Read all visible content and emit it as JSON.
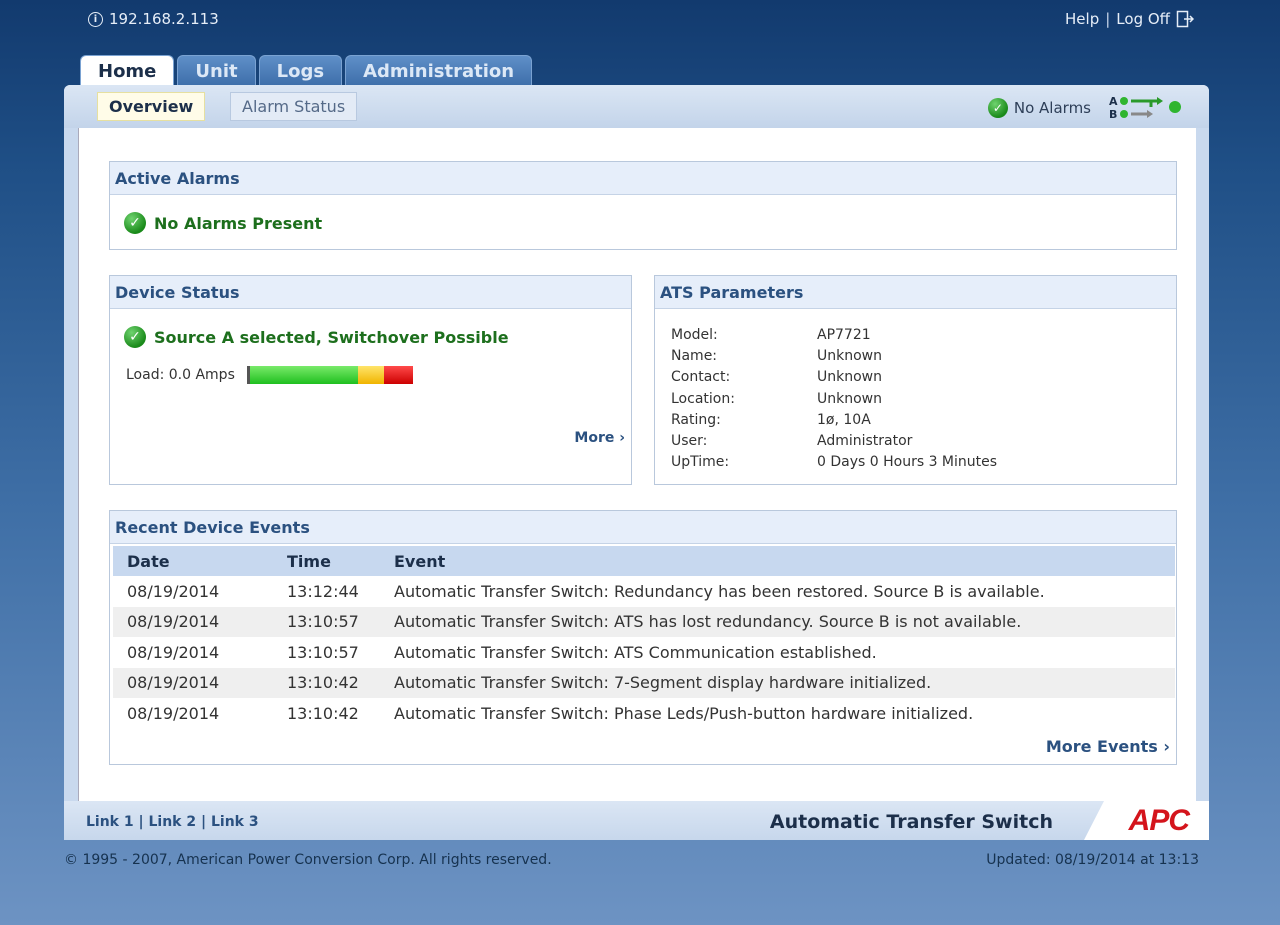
{
  "header": {
    "ip": "192.168.2.113",
    "help": "Help",
    "separator": "|",
    "logoff": "Log Off"
  },
  "tabs": [
    {
      "label": "Home"
    },
    {
      "label": "Unit"
    },
    {
      "label": "Logs"
    },
    {
      "label": "Administration"
    }
  ],
  "subtabs": [
    {
      "label": "Overview"
    },
    {
      "label": "Alarm Status"
    }
  ],
  "alarm_state": "No Alarms",
  "ats_status_icon": {
    "top_letter": "A",
    "bottom_letter": "B"
  },
  "active_alarms": {
    "title": "Active Alarms",
    "message": "No Alarms Present"
  },
  "device_status": {
    "title": "Device Status",
    "message": "Source A selected, Switchover Possible",
    "load_label": "Load: 0.0 Amps",
    "load_fraction": 0.0,
    "more": "More ›"
  },
  "ats_parameters": {
    "title": "ATS Parameters",
    "rows": [
      {
        "key": "Model:",
        "value": "AP7721"
      },
      {
        "key": "Name:",
        "value": "Unknown"
      },
      {
        "key": "Contact:",
        "value": "Unknown"
      },
      {
        "key": "Location:",
        "value": "Unknown"
      },
      {
        "key": "Rating:",
        "value": "1ø, 10A"
      },
      {
        "key": "User:",
        "value": "Administrator"
      },
      {
        "key": "UpTime:",
        "value": "0 Days 0 Hours 3 Minutes"
      }
    ]
  },
  "events": {
    "title": "Recent Device Events",
    "columns": [
      "Date",
      "Time",
      "Event"
    ],
    "rows": [
      {
        "date": "08/19/2014",
        "time": "13:12:44",
        "event": "Automatic Transfer Switch: Redundancy has been restored. Source B is available."
      },
      {
        "date": "08/19/2014",
        "time": "13:10:57",
        "event": "Automatic Transfer Switch: ATS has lost redundancy. Source B is not available."
      },
      {
        "date": "08/19/2014",
        "time": "13:10:57",
        "event": "Automatic Transfer Switch: ATS Communication established."
      },
      {
        "date": "08/19/2014",
        "time": "13:10:42",
        "event": "Automatic Transfer Switch: 7-Segment display hardware initialized."
      },
      {
        "date": "08/19/2014",
        "time": "13:10:42",
        "event": "Automatic Transfer Switch: Phase Leds/Push-button hardware initialized."
      }
    ],
    "more": "More Events ›"
  },
  "footer": {
    "links": [
      "Link 1",
      "Link 2",
      "Link 3"
    ],
    "link_separator": "|",
    "product": "Automatic Transfer Switch",
    "logo": "APC",
    "copyright": "© 1995 - 2007, American Power Conversion Corp. All rights reserved.",
    "updated": "Updated: 08/19/2014 at 13:13"
  },
  "colors": {
    "ok_green": "#1d6f1d",
    "link_blue": "#2b5180",
    "apc_red": "#d4141c"
  }
}
